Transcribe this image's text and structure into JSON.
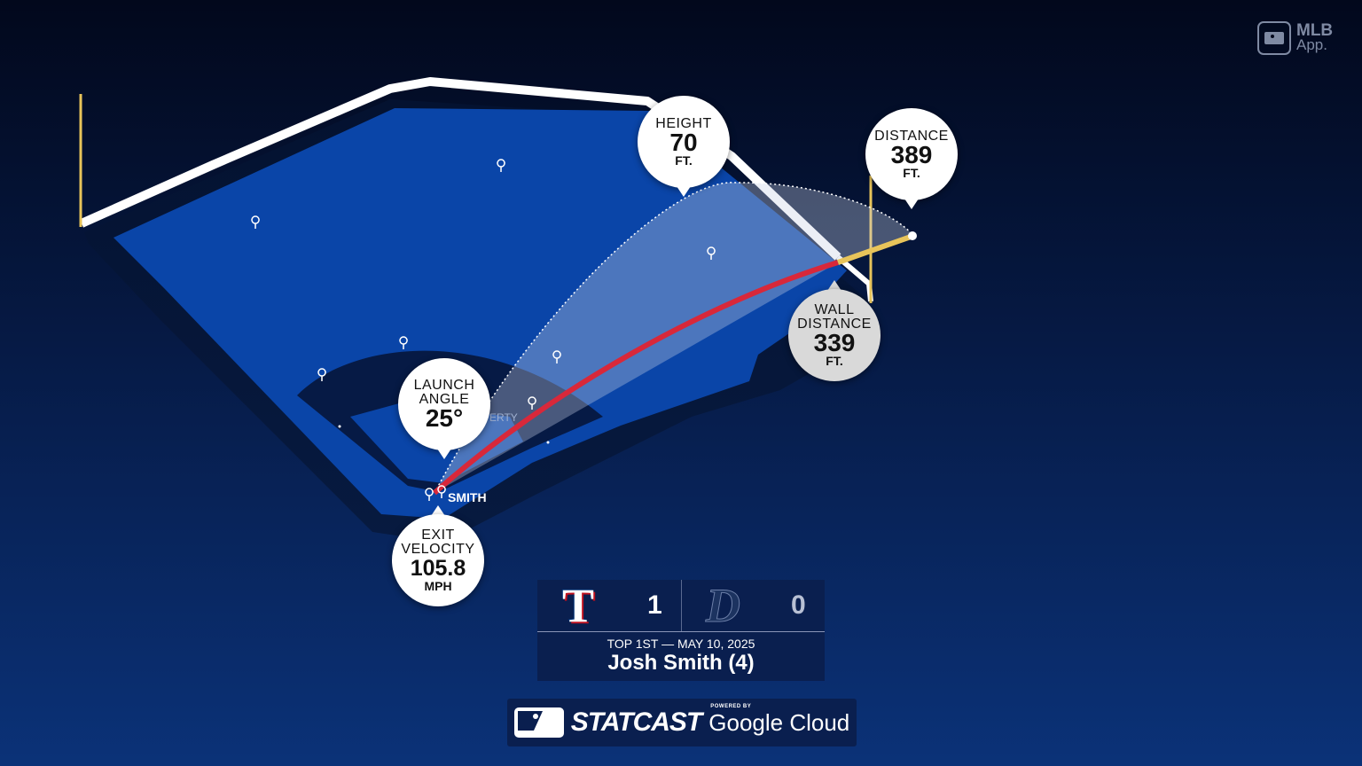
{
  "logo": {
    "line1": "MLB",
    "line2": "App."
  },
  "stats": {
    "height": {
      "label": "HEIGHT",
      "value": "70",
      "unit": "FT."
    },
    "distance": {
      "label": "DISTANCE",
      "value": "389",
      "unit": "FT."
    },
    "wall_distance": {
      "label1": "WALL",
      "label2": "DISTANCE",
      "value": "339",
      "unit": "FT."
    },
    "launch_angle": {
      "label1": "LAUNCH",
      "label2": "ANGLE",
      "value": "25°"
    },
    "exit_velocity": {
      "label1": "EXIT",
      "label2": "VELOCITY",
      "value": "105.8",
      "unit": "MPH"
    }
  },
  "field": {
    "batter_label": "SMITH",
    "signage_fragment": "ERTY"
  },
  "scoreboard": {
    "away_team_letter": "T",
    "home_team_letter": "D",
    "away_score": "1",
    "home_score": "0",
    "inning_date": "TOP 1ST — MAY 10, 2025",
    "player": "Josh Smith (4)"
  },
  "branding": {
    "statcast": "STATCAST",
    "powered_by": "POWERED BY",
    "google_cloud": "Google Cloud"
  },
  "colors": {
    "trajectory": "#d8283a",
    "foul_pole": "#e8c45a",
    "field": "#0a45a8",
    "wall": "#ffffff"
  }
}
